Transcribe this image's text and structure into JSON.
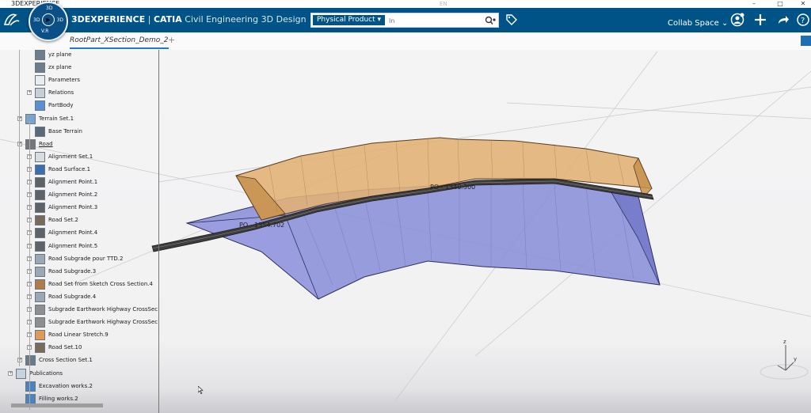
{
  "window": {
    "title": "3DEXPERIENCE",
    "lang_hint": "EN"
  },
  "header": {
    "product_brand": "3DEXPERIENCE",
    "product_app": "CATIA",
    "product_role": "Civil Engineering 3D Design",
    "compass": {
      "top": "3D",
      "left": "3D",
      "right": "3D",
      "vr": "V.R"
    },
    "search": {
      "scope": "Physical Product",
      "placeholder": "In"
    },
    "collab_space": "Collab Space"
  },
  "tabs": {
    "active": "RootPart_XSection_Demo_2",
    "add": "+"
  },
  "tree": {
    "items": [
      {
        "label": "yz plane",
        "icon": "plane-icon"
      },
      {
        "label": "zx plane",
        "icon": "plane-icon"
      },
      {
        "label": "Parameters",
        "icon": "parameters-icon"
      },
      {
        "label": "Relations",
        "icon": "relations-icon"
      },
      {
        "label": "PartBody",
        "icon": "partbody-icon"
      },
      {
        "label": "Terrain Set.1",
        "icon": "terrain-set-icon"
      },
      {
        "label": "Base Terrain",
        "icon": "terrain-icon"
      },
      {
        "label": "Road",
        "icon": "road-icon"
      },
      {
        "label": "Alignment Set.1",
        "icon": "alignment-set-icon"
      },
      {
        "label": "Road Surface.1",
        "icon": "road-surface-icon"
      },
      {
        "label": "Alignment Point.1",
        "icon": "alignment-point-icon"
      },
      {
        "label": "Alignment Point.2",
        "icon": "alignment-point-icon"
      },
      {
        "label": "Alignment Point.3",
        "icon": "alignment-point-icon"
      },
      {
        "label": "Road Set.2",
        "icon": "road-set-icon"
      },
      {
        "label": "Alignment Point.4",
        "icon": "alignment-point-icon"
      },
      {
        "label": "Alignment Point.5",
        "icon": "alignment-point-icon"
      },
      {
        "label": "Road Subgrade pour TTD.2",
        "icon": "subgrade-icon"
      },
      {
        "label": "Road Subgrade.3",
        "icon": "subgrade-icon"
      },
      {
        "label": "Road Set from Sketch Cross Section.4",
        "icon": "road-set-sketch-icon"
      },
      {
        "label": "Road Subgrade.4",
        "icon": "subgrade-icon"
      },
      {
        "label": "Subgrade Earthwork Highway CrossSec",
        "icon": "earthwork-icon"
      },
      {
        "label": "Subgrade Earthwork Highway CrossSec",
        "icon": "earthwork-icon"
      },
      {
        "label": "Road Linear Stretch.9",
        "icon": "linear-stretch-icon"
      },
      {
        "label": "Road Set.10",
        "icon": "road-set-icon"
      },
      {
        "label": "Cross Section Set.1",
        "icon": "cross-section-icon"
      },
      {
        "label": "Publications",
        "icon": "publications-icon"
      },
      {
        "label": "Excavation works.2",
        "icon": "publication-icon"
      },
      {
        "label": "Filling works.2",
        "icon": "publication-icon"
      }
    ]
  },
  "viewport": {
    "labels": {
      "station_a": "PO - 1354.702",
      "station_b": "PO - 1340.300"
    },
    "axes": {
      "z": "z",
      "y": "y"
    },
    "colors": {
      "embankment": "#e3b074",
      "cut_slope": "#8a8fd9",
      "road": "#3d3d3d",
      "header_bg": "#005386"
    }
  }
}
